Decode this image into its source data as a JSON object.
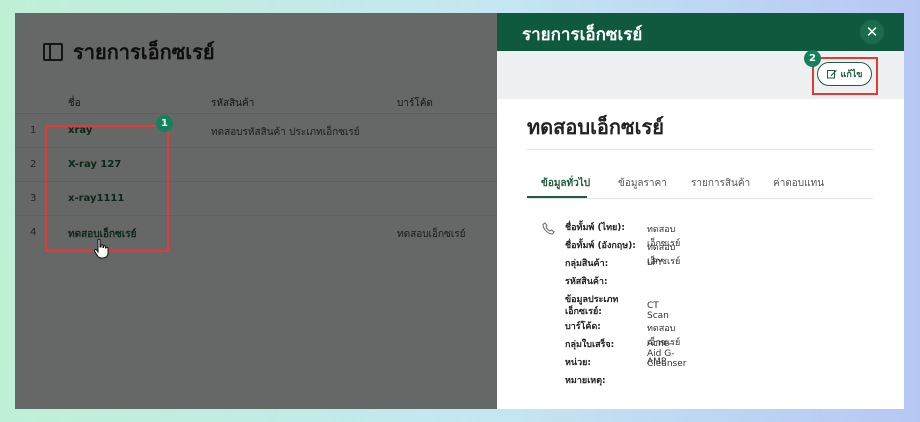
{
  "page": {
    "title": "รายการเอ็กซเรย์",
    "columns": [
      "ชื่อ",
      "รหัสสินค้า",
      "บาร์โค้ด"
    ],
    "rows": [
      {
        "index": "1",
        "name": "xray",
        "code": "ทดสอบรหัสสินค้า ประเภทเอ็กซเรย์",
        "barcode": ""
      },
      {
        "index": "2",
        "name": "X-ray 127",
        "code": "",
        "barcode": ""
      },
      {
        "index": "3",
        "name": "x-ray1111",
        "code": "",
        "barcode": ""
      },
      {
        "index": "4",
        "name": "ทดสอบเอ็กซเรย์",
        "code": "",
        "barcode": "ทดสอบเอ็กซเรย์"
      }
    ]
  },
  "annotations": {
    "badge1": "1",
    "badge2": "2"
  },
  "drawer": {
    "title": "รายการเอ็กซเรย์",
    "close_icon": "close-icon",
    "edit_label": "แก้ไข",
    "detail_title": "ทดสอบเอ็กซเรย์",
    "tabs": [
      "ข้อมูลทั่วไป",
      "ข้อมูลราคา",
      "รายการสินค้า",
      "ค่าตอบแทน"
    ],
    "active_tab": "ข้อมูลทั่วไป",
    "fields": [
      {
        "label": "ชื่อทั้มพ์ (ไทย):",
        "value": "ทดสอบเอ็กซเรย์"
      },
      {
        "label": "ชื่อทั้มพ์ (อังกฤษ):",
        "value": "ทดสอบเอ็กซเรย์"
      },
      {
        "label": "กลุ่มสินค้า:",
        "value": "LPY"
      },
      {
        "label": "รหัสสินค้า:",
        "value": ""
      },
      {
        "label": "ข้อมูลประเภท เอ็กซเรย์:",
        "value": "CT Scan"
      },
      {
        "label": "บาร์โค้ด:",
        "value": "ทดสอบเอ็กซเรย์"
      },
      {
        "label": "กลุ่มใบเสร็จ:",
        "value": "Acne-Aid G-Cleanser"
      },
      {
        "label": "หน่วย:",
        "value": "AMP"
      },
      {
        "label": "หมายเหตุ:",
        "value": ""
      }
    ]
  },
  "colors": {
    "brand_green": "#0f5a3e",
    "highlight_red": "#e53935",
    "badge_green": "#13825a"
  }
}
